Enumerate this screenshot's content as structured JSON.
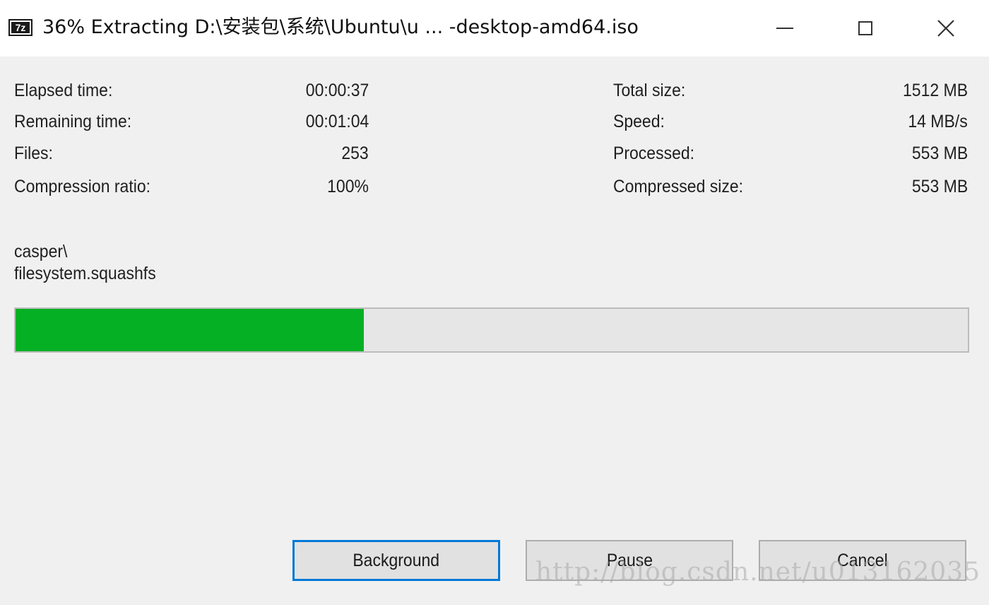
{
  "window": {
    "title": "36% Extracting D:\\安装包\\系统\\Ubuntu\\u ... -desktop-amd64.iso",
    "app_icon_text": "7z"
  },
  "stats_left": [
    {
      "label": "Elapsed time:",
      "value": "00:00:37"
    },
    {
      "label": "Remaining time:",
      "value": "00:01:04"
    },
    {
      "label": "Files:",
      "value": "253"
    },
    {
      "label": "Compression ratio:",
      "value": "100%"
    }
  ],
  "stats_right": [
    {
      "label": "Total size:",
      "value": "1512 MB"
    },
    {
      "label": "Speed:",
      "value": "14 MB/s"
    },
    {
      "label": "Processed:",
      "value": "553 MB"
    },
    {
      "label": "Compressed size:",
      "value": "553 MB"
    }
  ],
  "current_file": {
    "folder": "casper\\",
    "name": "filesystem.squashfs"
  },
  "progress": {
    "percent": 36.6,
    "fill_color": "#06b025"
  },
  "buttons": {
    "background": "Background",
    "pause": "Pause",
    "cancel": "Cancel"
  },
  "watermark": "http://blog.csdn.net/u013162035",
  "icons": {
    "minimize": "minimize-icon",
    "maximize": "maximize-icon",
    "close": "close-icon"
  }
}
